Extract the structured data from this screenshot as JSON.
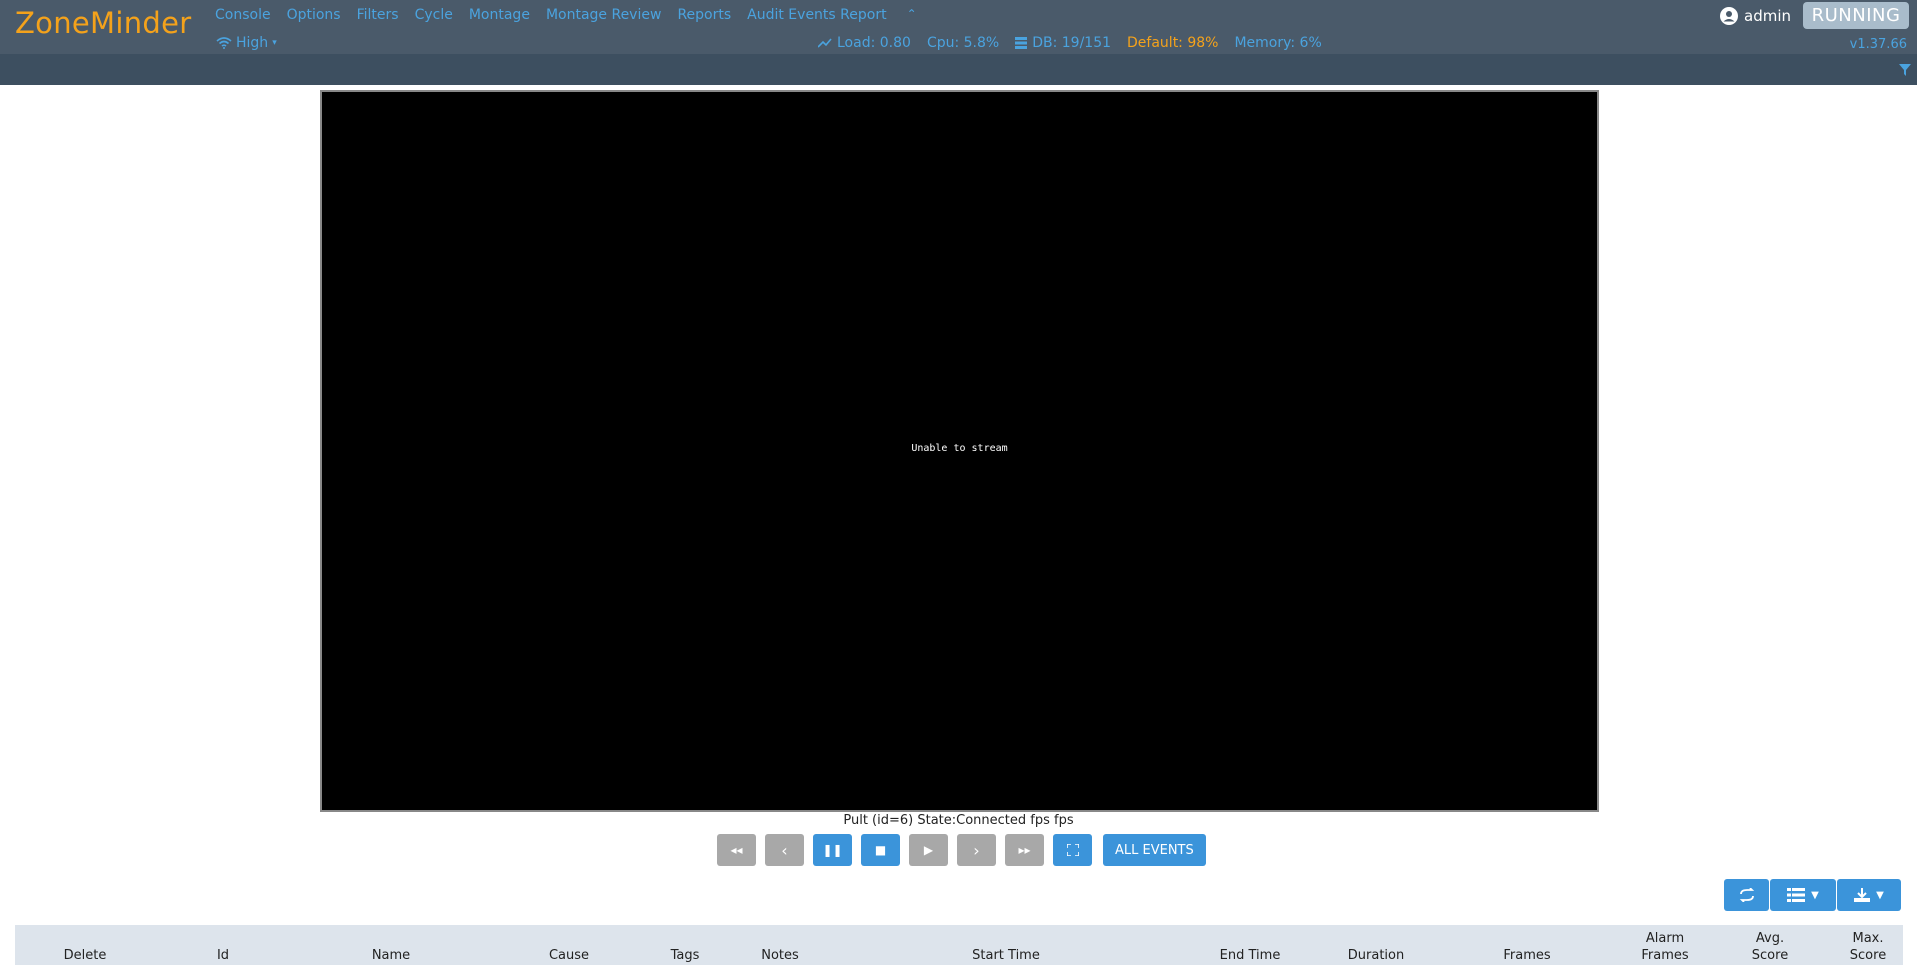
{
  "app": {
    "title": "ZoneMinder",
    "version": "v1.37.66",
    "state": "RUNNING",
    "user": "admin"
  },
  "nav": [
    "Console",
    "Options",
    "Filters",
    "Cycle",
    "Montage",
    "Montage Review",
    "Reports",
    "Audit Events Report"
  ],
  "bandwidth": "High",
  "stats": {
    "load": "Load: 0.80",
    "cpu": "Cpu: 5.8%",
    "db": "DB: 19/151",
    "disk": "Default: 98%",
    "memory": "Memory: 6%"
  },
  "stream": {
    "message": "Unable to stream",
    "status": "Pult (id=6) State:Connected fps fps"
  },
  "controls": {
    "all_events": "ALL EVENTS"
  },
  "table": {
    "headers": [
      "Delete",
      "Id",
      "Name",
      "Cause",
      "Tags",
      "Notes",
      "Start Time",
      "End Time",
      "Duration",
      "Frames",
      "Alarm Frames",
      "Avg. Score",
      "Max. Score"
    ]
  },
  "colors": {
    "header_bg": "#4a5a6a",
    "accent": "#4aa3df",
    "logo": "#f4a21b",
    "button": "#3b94da"
  }
}
